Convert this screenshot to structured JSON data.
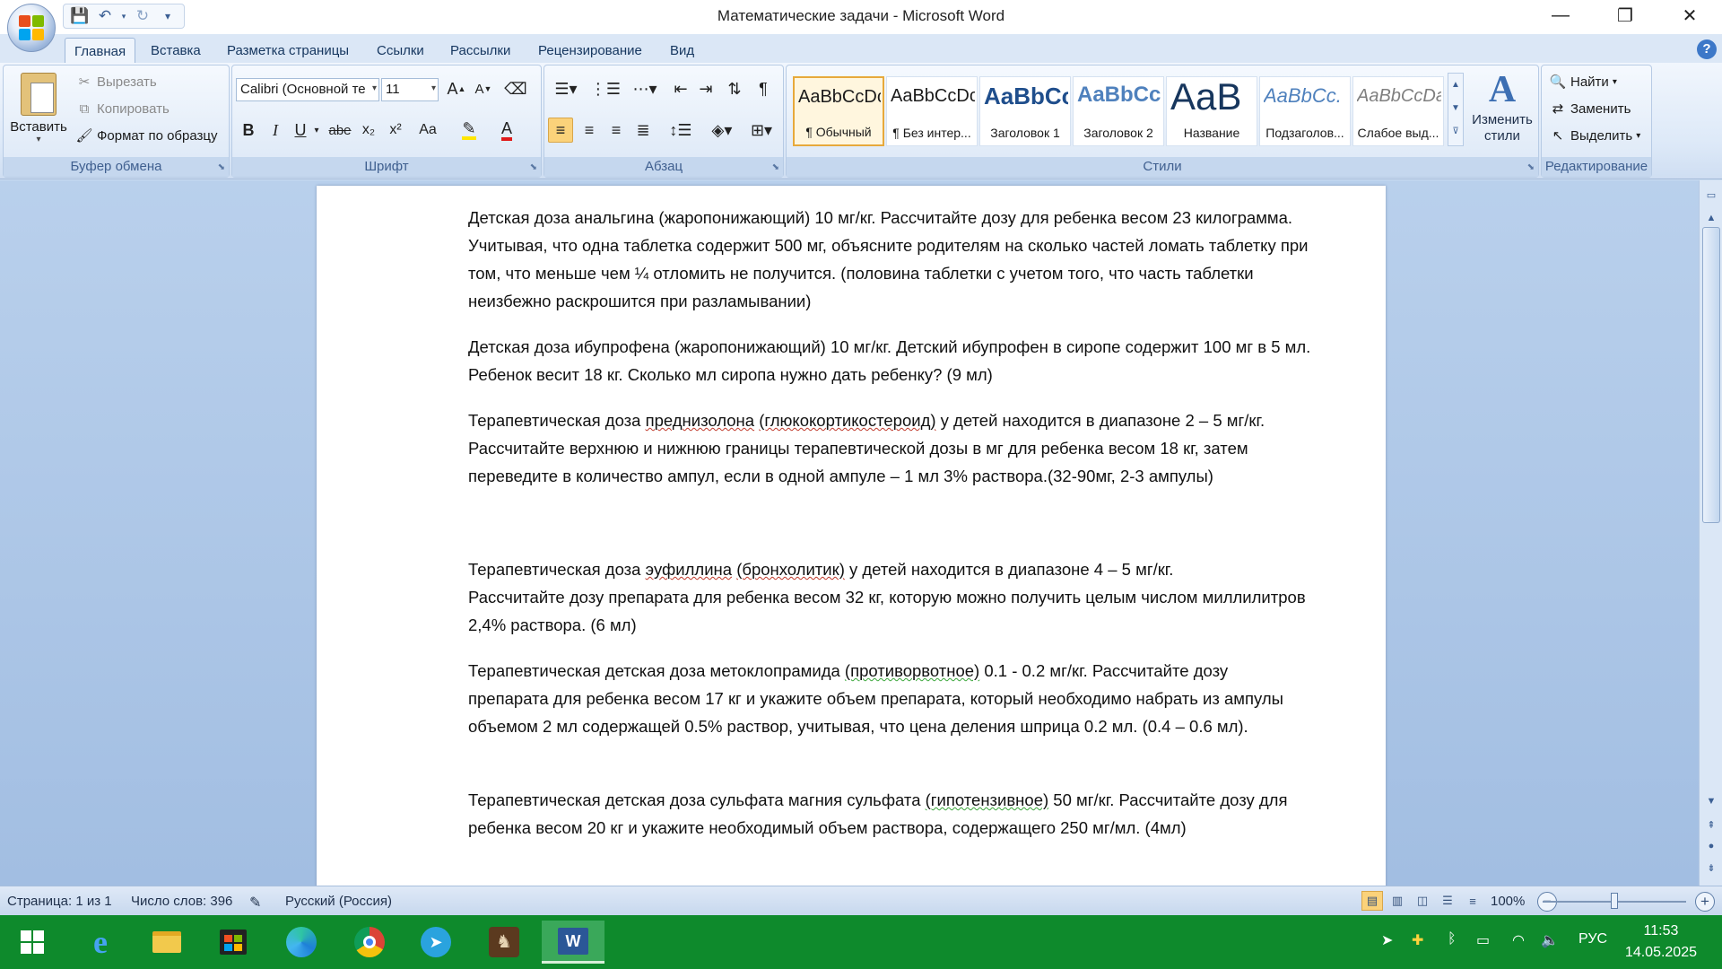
{
  "window": {
    "title": "Математические задачи - Microsoft Word",
    "minimize": "—",
    "maximize": "❐",
    "close": "✕"
  },
  "tabs": [
    "Главная",
    "Вставка",
    "Разметка страницы",
    "Ссылки",
    "Рассылки",
    "Рецензирование",
    "Вид"
  ],
  "clipboard": {
    "paste": "Вставить",
    "cut": "Вырезать",
    "copy": "Копировать",
    "format_painter": "Формат по образцу",
    "label": "Буфер обмена"
  },
  "font": {
    "name": "Calibri (Основной те",
    "size": "11",
    "label": "Шрифт",
    "bold": "B",
    "italic": "I",
    "underline": "U",
    "strike": "abe",
    "subscript": "x₂",
    "superscript": "x²",
    "change_case": "Aa"
  },
  "paragraph": {
    "label": "Абзац"
  },
  "styles": {
    "label": "Стили",
    "items": [
      {
        "sample": "AaBbCcDc",
        "name": "¶ Обычный"
      },
      {
        "sample": "AaBbCcDc",
        "name": "¶ Без интер..."
      },
      {
        "sample": "AaBbCc",
        "name": "Заголовок 1"
      },
      {
        "sample": "AaBbCc",
        "name": "Заголовок 2"
      },
      {
        "sample": "AaB",
        "name": "Название"
      },
      {
        "sample": "AaBbCc.",
        "name": "Подзаголов..."
      },
      {
        "sample": "AaBbCcDa",
        "name": "Слабое выд..."
      }
    ],
    "change_styles": "Изменить стили"
  },
  "editing": {
    "label": "Редактирование",
    "find": "Найти",
    "replace": "Заменить",
    "select": "Выделить"
  },
  "document": {
    "paragraphs": [
      {
        "parts": [
          {
            "t": "Детская доза анальгина (жаропонижающий) 10 мг/кг. Рассчитайте дозу для ребенка весом 23 килограмма. Учитывая, что одна таблетка содержит 500 мг, объясните родителям на сколько частей ломать таблетку при том, что меньше чем ¼ отломить не получится. (половина таблетки с учетом того, что часть таблетки неизбежно раскрошится при разламывании)"
          }
        ]
      },
      {
        "parts": [
          {
            "t": "Детская доза ибупрофена (жаропонижающий) 10 мг/кг. Детский ибупрофен в сиропе содержит 100 мг в 5 мл. Ребенок  весит 18 кг. Сколько мл сиропа нужно дать ребенку? (9 мл)"
          }
        ]
      },
      {
        "parts": [
          {
            "t": "Терапевтическая доза "
          },
          {
            "t": "преднизолона",
            "u": "red"
          },
          {
            "t": " "
          },
          {
            "t": "(глюкокортикостероид)",
            "u": "red"
          },
          {
            "t": " у детей находится в диапазоне 2 – 5 мг/кг."
          },
          {
            "t": "\nРассчитайте верхнюю и нижнюю границы терапевтической дозы в мг для ребенка весом 18 кг, затем переведите в количество ампул, если в одной ампуле – 1 мл 3% раствора.(32-90мг, 2-3 ампулы)"
          }
        ]
      },
      {
        "parts": [
          {
            "t": "Терапевтическая доза "
          },
          {
            "t": "эуфиллина",
            "u": "red"
          },
          {
            "t": " "
          },
          {
            "t": "(бронхолитик)",
            "u": "red"
          },
          {
            "t": " у детей находится в диапазоне 4 – 5 мг/кг.\nРассчитайте дозу препарата для ребенка весом 32 кг, которую можно получить целым числом миллилитров 2,4% раствора. (6 мл)"
          }
        ]
      },
      {
        "parts": [
          {
            "t": "Терапевтическая детская доза метоклопрамида "
          },
          {
            "t": "(противорвотное)",
            "u": "green"
          },
          {
            "t": " 0.1 - 0.2 мг/кг. Рассчитайте дозу препарата для ребенка весом 17 кг и укажите объем препарата, который необходимо набрать из ампулы объемом 2 мл содержащей 0.5% раствор, учитывая, что цена деления шприца 0.2 мл. (0.4 – 0.6 мл)."
          }
        ]
      },
      {
        "parts": [
          {
            "t": "Терапевтическая детская доза сульфата магния сульфата "
          },
          {
            "t": "(гипотензивное)",
            "u": "green"
          },
          {
            "t": " 50 мг/кг. Рассчитайте дозу для ребенка весом 20 кг и укажите необходимый объем раствора, содержащего 250 мг/мл. (4мл)"
          }
        ]
      }
    ]
  },
  "status": {
    "page": "Страница: 1 из 1",
    "words": "Число слов: 396",
    "language": "Русский (Россия)",
    "zoom": "100%",
    "zoom_level": 0.5
  },
  "taskbar": {
    "lang": "РУС",
    "time": "11:53",
    "date": "14.05.2025"
  },
  "colors": {
    "taskbar": "#0e8a2c",
    "accent": "#fbd27a",
    "ribbon_text": "#3f5f8f"
  }
}
